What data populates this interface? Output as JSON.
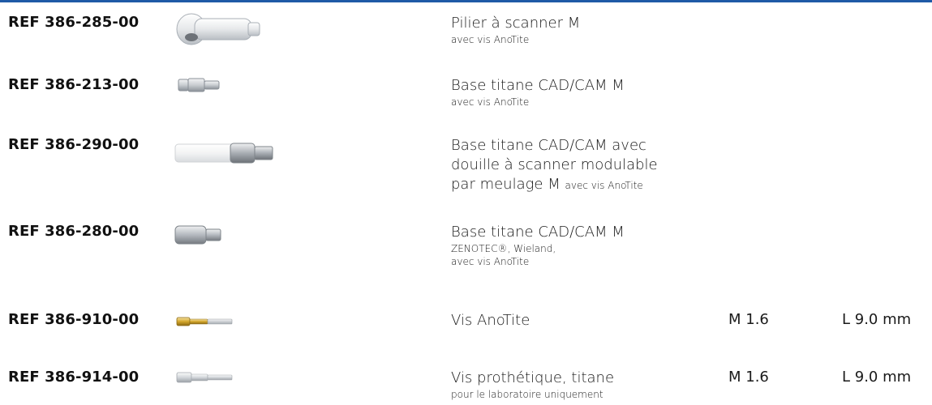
{
  "items": [
    {
      "ref": "REF 386-285-00",
      "image": "scan-body-icon",
      "title": "Pilier à scanner M",
      "subtitle": "avec vis AnoTite"
    },
    {
      "ref": "REF 386-213-00",
      "image": "titanium-base-icon",
      "title": "Base titane CAD/CAM M",
      "subtitle": "avec vis AnoTite"
    },
    {
      "ref": "REF 386-290-00",
      "image": "titanium-base-sleeve-icon",
      "title_line1": "Base titane CAD/CAM avec",
      "title_line2": "douille à scanner modulable",
      "title_line3": "par meulage M",
      "subtitle": "avec vis AnoTite"
    },
    {
      "ref": "REF 386-280-00",
      "image": "titanium-base-zenotec-icon",
      "title": "Base titane CAD/CAM M",
      "subtitle_line1": "ZENOTEC®, Wieland,",
      "subtitle_line2": "avec vis AnoTite"
    },
    {
      "ref": "REF 386-910-00",
      "image": "gold-screw-icon",
      "title": "Vis AnoTite",
      "size": "M 1.6",
      "length": "L 9.0 mm"
    },
    {
      "ref": "REF 386-914-00",
      "image": "titanium-screw-icon",
      "title": "Vis prothétique, titane",
      "subtitle": "pour le laboratoire uniquement",
      "size": "M 1.6",
      "length": "L 9.0 mm"
    }
  ],
  "colors": {
    "rule": "#1f5aa6",
    "titanium": "#c9cdd1",
    "white_part": "#eceeee",
    "gold": "#d4a62a"
  }
}
